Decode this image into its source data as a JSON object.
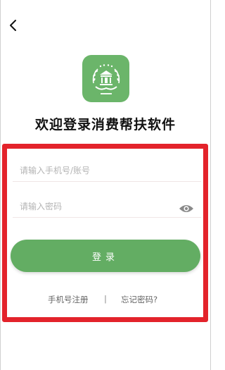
{
  "header": {
    "back_icon": "chevron-left-icon"
  },
  "logo": {
    "icon": "app-logo-icon",
    "color": "#6bb56a"
  },
  "title": "欢迎登录消费帮扶软件",
  "form": {
    "account_placeholder": "请输入手机号/账号",
    "password_placeholder": "请输入密码",
    "eye_icon": "eye-icon",
    "login_label": "登录",
    "button_color": "#63ad63"
  },
  "links": {
    "register_label": "手机号注册",
    "separator": "|",
    "forgot_label": "忘记密码?"
  },
  "highlight": {
    "color": "#e3232b"
  }
}
